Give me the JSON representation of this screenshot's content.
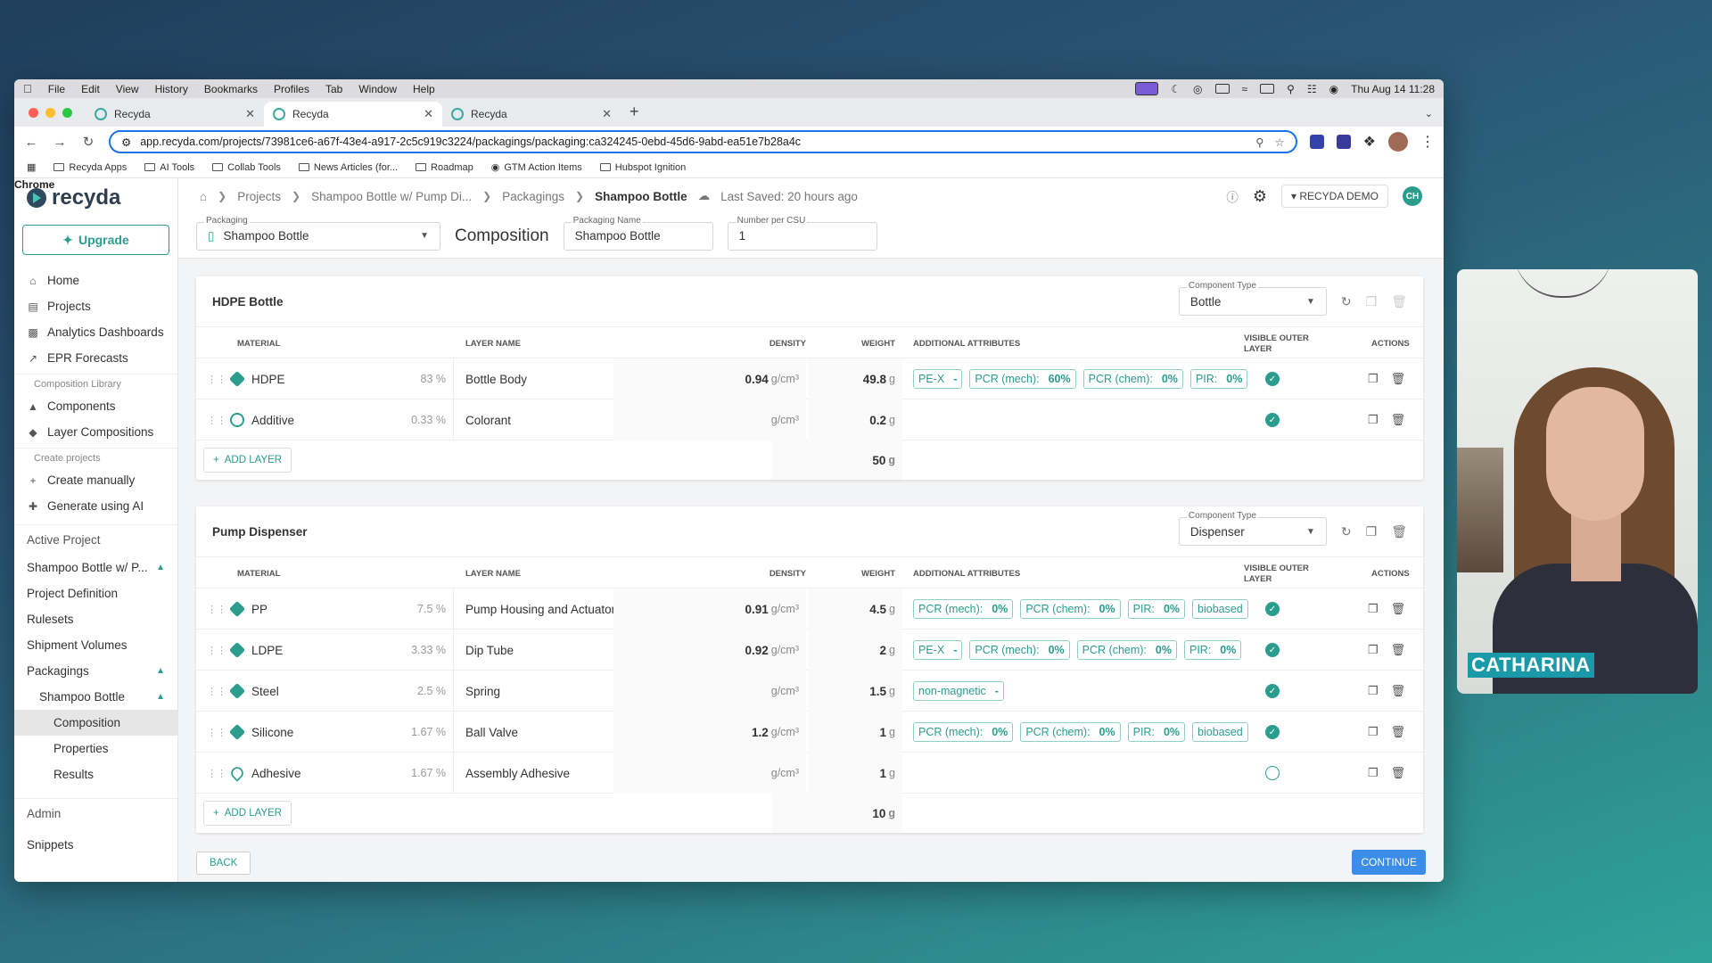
{
  "menubar": {
    "app": "Chrome",
    "items": [
      "File",
      "Edit",
      "View",
      "History",
      "Bookmarks",
      "Profiles",
      "Tab",
      "Window",
      "Help"
    ],
    "clock": "Thu Aug 14  11:28"
  },
  "tabs": [
    {
      "label": "Recyda"
    },
    {
      "label": "Recyda"
    },
    {
      "label": "Recyda"
    }
  ],
  "address": {
    "url": "app.recyda.com/projects/73981ce6-a67f-43e4-a917-2c5c919c3224/packagings/packaging:ca324245-0ebd-45d6-9abd-ea51e7b28a4c"
  },
  "bookmarks": [
    "Recyda Apps",
    "AI Tools",
    "Collab Tools",
    "News Articles (for...",
    "Roadmap",
    "GTM Action Items",
    "Hubspot Ignition"
  ],
  "brand": {
    "name": "recyda",
    "accent": "#2a9d8f"
  },
  "sidebar": {
    "upgrade": "Upgrade",
    "nav": [
      "Home",
      "Projects",
      "Analytics Dashboards",
      "EPR Forecasts"
    ],
    "lib_header": "Composition Library",
    "lib": [
      "Components",
      "Layer Compositions"
    ],
    "create_header": "Create projects",
    "create": [
      "Create manually",
      "Generate using AI"
    ],
    "active_header": "Active Project",
    "project": "Shampoo Bottle w/ P...",
    "project_items": [
      "Project Definition",
      "Rulesets",
      "Shipment Volumes"
    ],
    "packagings": "Packagings",
    "packaging": "Shampoo Bottle",
    "packaging_items": [
      "Composition",
      "Properties",
      "Results"
    ],
    "admin": "Admin",
    "snippets": "Snippets"
  },
  "breadcrumb": {
    "projects": "Projects",
    "project": "Shampoo Bottle w/ Pump Di...",
    "packagings": "Packagings",
    "current": "Shampoo Bottle",
    "saved": "Last Saved: 20 hours ago"
  },
  "user": {
    "org": "RECYDA DEMO",
    "initials": "CH"
  },
  "form": {
    "packaging_label": "Packaging",
    "packaging_value": "Shampoo Bottle",
    "title": "Composition",
    "name_label": "Packaging Name",
    "name_value": "Shampoo Bottle",
    "csu_label": "Number per CSU",
    "csu_value": "1"
  },
  "columns": {
    "material": "MATERIAL",
    "layer": "LAYER NAME",
    "density": "DENSITY",
    "weight": "WEIGHT",
    "attrs": "ADDITIONAL ATTRIBUTES",
    "visible1": "VISIBLE OUTER",
    "visible2": "LAYER",
    "actions": "ACTIONS"
  },
  "components": [
    {
      "title": "HDPE Bottle",
      "type_label": "Component Type",
      "type": "Bottle",
      "add_layer": "ADD LAYER",
      "total": "50",
      "total_unit": "g",
      "rows": [
        {
          "material": "HDPE",
          "pct": "83 %",
          "layer": "Bottle Body",
          "density": "0.94",
          "dunit": "g/cm³",
          "weight": "49.8",
          "wunit": "g",
          "chips": [
            {
              "k": "PE-X",
              "v": "-"
            },
            {
              "k": "PCR (mech):",
              "v": "60%"
            },
            {
              "k": "PCR (chem):",
              "v": "0%"
            },
            {
              "k": "PIR:",
              "v": "0%"
            }
          ],
          "visible": true
        },
        {
          "material": "Additive",
          "pct": "0.33 %",
          "layer": "Colorant",
          "density": "",
          "dunit": "g/cm³",
          "weight": "0.2",
          "wunit": "g",
          "chips": [],
          "visible": true
        }
      ]
    },
    {
      "title": "Pump Dispenser",
      "type_label": "Component Type",
      "type": "Dispenser",
      "add_layer": "ADD LAYER",
      "total": "10",
      "total_unit": "g",
      "rows": [
        {
          "material": "PP",
          "pct": "7.5 %",
          "layer": "Pump Housing and Actuator",
          "density": "0.91",
          "dunit": "g/cm³",
          "weight": "4.5",
          "wunit": "g",
          "chips": [
            {
              "k": "PCR (mech):",
              "v": "0%"
            },
            {
              "k": "PCR (chem):",
              "v": "0%"
            },
            {
              "k": "PIR:",
              "v": "0%"
            },
            {
              "k": "biobased",
              "v": ""
            }
          ],
          "visible": true
        },
        {
          "material": "LDPE",
          "pct": "3.33 %",
          "layer": "Dip Tube",
          "density": "0.92",
          "dunit": "g/cm³",
          "weight": "2",
          "wunit": "g",
          "chips": [
            {
              "k": "PE-X",
              "v": "-"
            },
            {
              "k": "PCR (mech):",
              "v": "0%"
            },
            {
              "k": "PCR (chem):",
              "v": "0%"
            },
            {
              "k": "PIR:",
              "v": "0%"
            }
          ],
          "visible": true
        },
        {
          "material": "Steel",
          "pct": "2.5 %",
          "layer": "Spring",
          "density": "",
          "dunit": "g/cm³",
          "weight": "1.5",
          "wunit": "g",
          "chips": [
            {
              "k": "non-magnetic",
              "v": "-"
            }
          ],
          "visible": true
        },
        {
          "material": "Silicone",
          "pct": "1.67 %",
          "layer": "Ball Valve",
          "density": "1.2",
          "dunit": "g/cm³",
          "weight": "1",
          "wunit": "g",
          "chips": [
            {
              "k": "PCR (mech):",
              "v": "0%"
            },
            {
              "k": "PCR (chem):",
              "v": "0%"
            },
            {
              "k": "PIR:",
              "v": "0%"
            },
            {
              "k": "biobased",
              "v": ""
            }
          ],
          "visible": true
        },
        {
          "material": "Adhesive",
          "pct": "1.67 %",
          "layer": "Assembly Adhesive",
          "density": "",
          "dunit": "g/cm³",
          "weight": "1",
          "wunit": "g",
          "chips": [],
          "visible": false
        }
      ]
    }
  ],
  "footer": {
    "back": "BACK",
    "continue": "CONTINUE"
  },
  "webcam": {
    "name": "CATHARINA"
  }
}
